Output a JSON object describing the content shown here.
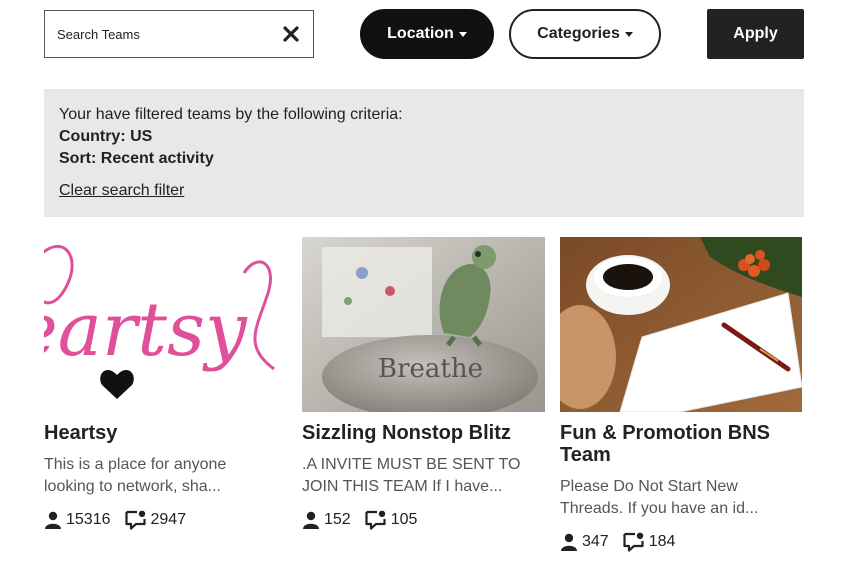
{
  "search": {
    "placeholder": "Search Teams",
    "value": ""
  },
  "filters": {
    "location_label": "Location",
    "categories_label": "Categories",
    "apply_label": "Apply"
  },
  "filter_info": {
    "intro": "Your have filtered teams by the following criteria:",
    "country": "Country: US",
    "sort": "Sort: Recent activity",
    "clear_link": "Clear search filter"
  },
  "teams": [
    {
      "title": "Heartsy",
      "description_line1": "This is a place for anyone",
      "description_line2": "looking to network, sha...",
      "members": "15316",
      "posts": "2947",
      "image_text": "eartsy"
    },
    {
      "title": "Sizzling Nonstop Blitz",
      "description_line1": ".A INVITE MUST BE SENT TO",
      "description_line2": "JOIN THIS TEAM If I have...",
      "members": "152",
      "posts": "105",
      "image_text": "Breathe"
    },
    {
      "title_line1": "Fun & Promotion BNS",
      "title_line2": "Team",
      "description_line1": "Please Do Not Start New",
      "description_line2": "Threads. If you have an id...",
      "members": "347",
      "posts": "184"
    }
  ],
  "colors": {
    "dark": "#222222",
    "panel": "#e8e8e8",
    "muted_text": "#555555",
    "heart_pink": "#e0509a"
  }
}
